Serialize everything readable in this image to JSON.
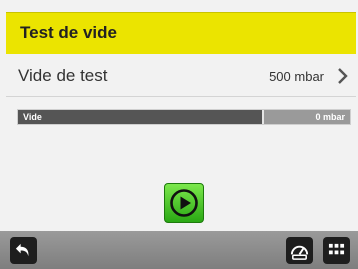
{
  "header": {
    "title": "Test de vide"
  },
  "setting": {
    "label": "Vide de test",
    "value": "500 mbar"
  },
  "vacuum_bar": {
    "label": "Vide",
    "value": "0 mbar"
  },
  "icons": {
    "chevron": "chevron-right-icon",
    "play": "play-icon",
    "back": "back-icon",
    "gauge": "gauge-icon",
    "menu": "grid-menu-icon"
  },
  "colors": {
    "title_bar": "#ebe400",
    "play_button": "#3cc41e",
    "bottom_bar": "#8a8a8a"
  }
}
